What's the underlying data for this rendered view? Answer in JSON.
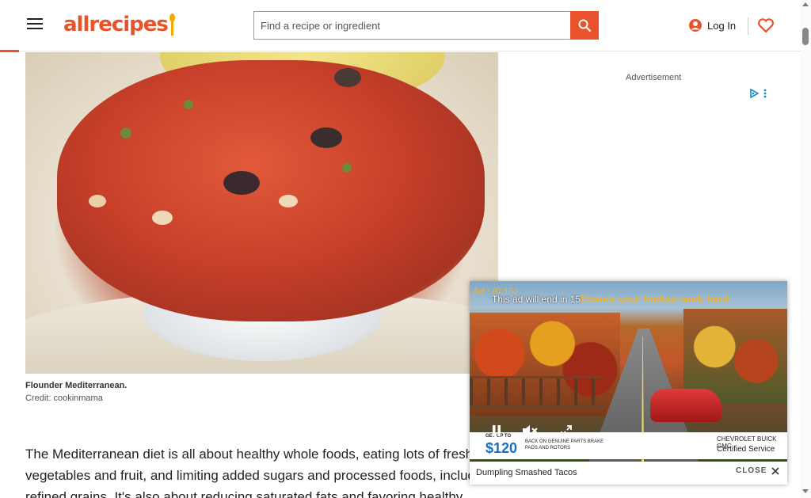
{
  "header": {
    "logo_text": "allrecipes",
    "search_placeholder": "Find a recipe or ingredient",
    "login_label": "Log In",
    "accent_color": "#e8532b"
  },
  "icons": {
    "menu": "hamburger-icon",
    "search": "search-icon",
    "user": "user-icon",
    "saved": "heart-icon",
    "adchoices": "adchoices-icon",
    "play_pause": "pause-icon",
    "mute": "mute-icon",
    "fullscreen": "fullscreen-icon",
    "close": "close-icon"
  },
  "article": {
    "image_caption": "Flounder Mediterranean.",
    "image_credit": "Credit: cookinmama",
    "body_text": "The Mediterranean diet is all about healthy whole foods, eating lots of fresh vegetables and fruit, and limiting added sugars and processed foods, including refined grains. It's also about reducing saturated fats and favoring healthy"
  },
  "ads": {
    "sidebar_label": "Advertisement",
    "video": {
      "timer": "Ad : (0:15)",
      "ends_in": "This ad will end in 15",
      "headline": "Ensure your brakes work hard",
      "promo_up_to": "GET UP TO",
      "promo_amount": "$120",
      "promo_desc": "BACK ON GENUINE PARTS BRAKE PADS AND ROTORS",
      "promo_brands": "CHEVROLET  BUICK  GMC",
      "promo_cert": "Certified Service",
      "title": "Dumpling Smashed Tacos",
      "close_label": "CLOSE"
    }
  }
}
